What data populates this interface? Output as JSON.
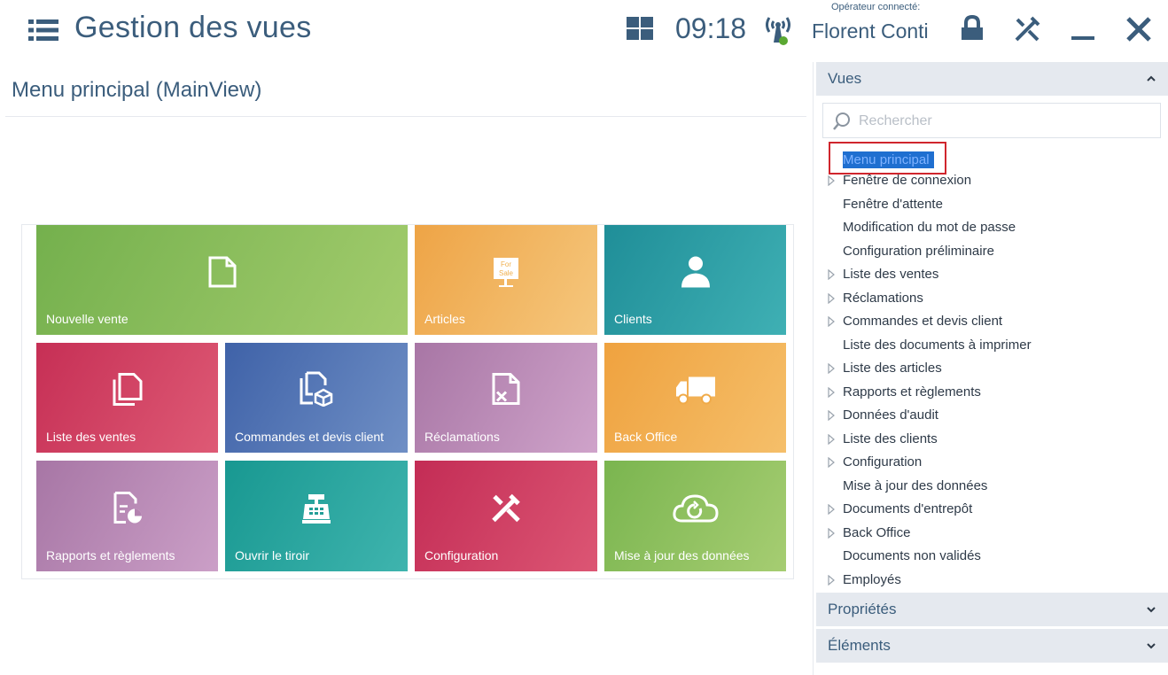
{
  "topbar": {
    "app_title": "Gestion des vues",
    "clock": "09:18",
    "operator_label": "Opérateur connecté:",
    "operator_name": "Florent Conti",
    "icons": [
      "menu-icon",
      "tiles-icon",
      "signal-icon",
      "lock-icon",
      "tools-icon",
      "minimize-icon",
      "close-icon"
    ]
  },
  "main": {
    "page_title": "Menu principal (MainView)",
    "tiles": [
      {
        "label": "Nouvelle vente",
        "icon": "new-document-icon",
        "color": "#7db75a"
      },
      {
        "label": "Articles",
        "icon": "for-sale-sign-icon",
        "color": "#f0b04e"
      },
      {
        "label": "Clients",
        "icon": "person-icon",
        "color": "#2a9aa3"
      },
      {
        "label": "Liste des ventes",
        "icon": "documents-icon",
        "color": "#c93a5e"
      },
      {
        "label": "Commandes et devis client",
        "icon": "document-package-icon",
        "color": "#4d6fb0"
      },
      {
        "label": "Réclamations",
        "icon": "document-x-icon",
        "color": "#b986b3"
      },
      {
        "label": "Back Office",
        "icon": "truck-icon",
        "color": "#f0aa48"
      },
      {
        "label": "Rapports et règlements",
        "icon": "report-icon",
        "color": "#b382b0"
      },
      {
        "label": "Ouvrir le tiroir",
        "icon": "cash-register-icon",
        "color": "#239e97"
      },
      {
        "label": "Configuration",
        "icon": "tools-icon",
        "color": "#c93a5e"
      },
      {
        "label": "Mise à jour des données",
        "icon": "cloud-sync-icon",
        "color": "#86bb5c"
      }
    ]
  },
  "sidepanel": {
    "vues_title": "Vues",
    "search_placeholder": "Rechercher",
    "selected_item": "Menu principal",
    "tree": [
      {
        "label": "Fenêtre de connexion",
        "expandable": true
      },
      {
        "label": "Fenêtre d'attente",
        "expandable": false
      },
      {
        "label": "Modification du mot de passe",
        "expandable": false
      },
      {
        "label": "Configuration préliminaire",
        "expandable": false
      },
      {
        "label": "Liste des ventes",
        "expandable": true
      },
      {
        "label": "Réclamations",
        "expandable": true
      },
      {
        "label": "Commandes et devis client",
        "expandable": true
      },
      {
        "label": "Liste des documents à imprimer",
        "expandable": false
      },
      {
        "label": "Liste des articles",
        "expandable": true
      },
      {
        "label": "Rapports et règlements",
        "expandable": true
      },
      {
        "label": "Données d'audit",
        "expandable": true
      },
      {
        "label": "Liste des clients",
        "expandable": true
      },
      {
        "label": "Configuration",
        "expandable": true
      },
      {
        "label": "Mise à jour des données",
        "expandable": false
      },
      {
        "label": "Documents d'entrepôt",
        "expandable": true
      },
      {
        "label": "Back Office",
        "expandable": true
      },
      {
        "label": "Documents non validés",
        "expandable": false
      },
      {
        "label": "Employés",
        "expandable": true
      }
    ],
    "proprietes_title": "Propriétés",
    "elements_title": "Éléments"
  },
  "colors": {
    "title_blue": "#3b5d7c",
    "selection_blue": "#1f6fd0",
    "highlight_red": "#d0262d",
    "accordion_bg": "#e5e9ef"
  }
}
